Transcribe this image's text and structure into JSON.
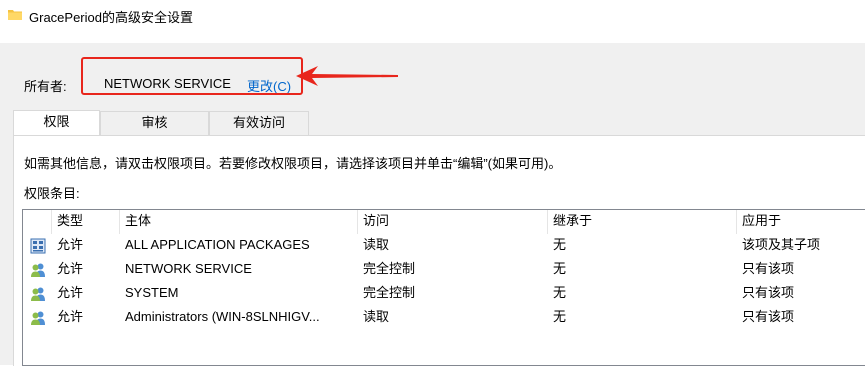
{
  "window": {
    "title": "GracePeriod的高级安全设置"
  },
  "owner": {
    "label": "所有者:",
    "value": "NETWORK SERVICE",
    "change_link": "更改(C)"
  },
  "tabs": [
    {
      "label": "权限",
      "active": true
    },
    {
      "label": "审核",
      "active": false
    },
    {
      "label": "有效访问",
      "active": false
    }
  ],
  "panel": {
    "info": "如需其他信息，请双击权限项目。若要修改权限项目，请选择该项目并单击“编辑”(如果可用)。",
    "entries_label": "权限条目:"
  },
  "table": {
    "columns": [
      "类型",
      "主体",
      "访问",
      "继承于",
      "应用于"
    ],
    "rows": [
      {
        "icon": "package-group-icon",
        "type": "允许",
        "principal": "ALL APPLICATION PACKAGES",
        "access": "读取",
        "inherited": "无",
        "applies": "该项及其子项"
      },
      {
        "icon": "users-group-icon",
        "type": "允许",
        "principal": "NETWORK SERVICE",
        "access": "完全控制",
        "inherited": "无",
        "applies": "只有该项"
      },
      {
        "icon": "users-group-icon",
        "type": "允许",
        "principal": "SYSTEM",
        "access": "完全控制",
        "inherited": "无",
        "applies": "只有该项"
      },
      {
        "icon": "users-group-icon",
        "type": "允许",
        "principal": "Administrators (WIN-8SLNHIGV...",
        "access": "读取",
        "inherited": "无",
        "applies": "只有该项"
      }
    ]
  },
  "colors": {
    "link": "#0066cc",
    "annotation": "#e8261c",
    "dialog_bg": "#f0f0f0"
  }
}
